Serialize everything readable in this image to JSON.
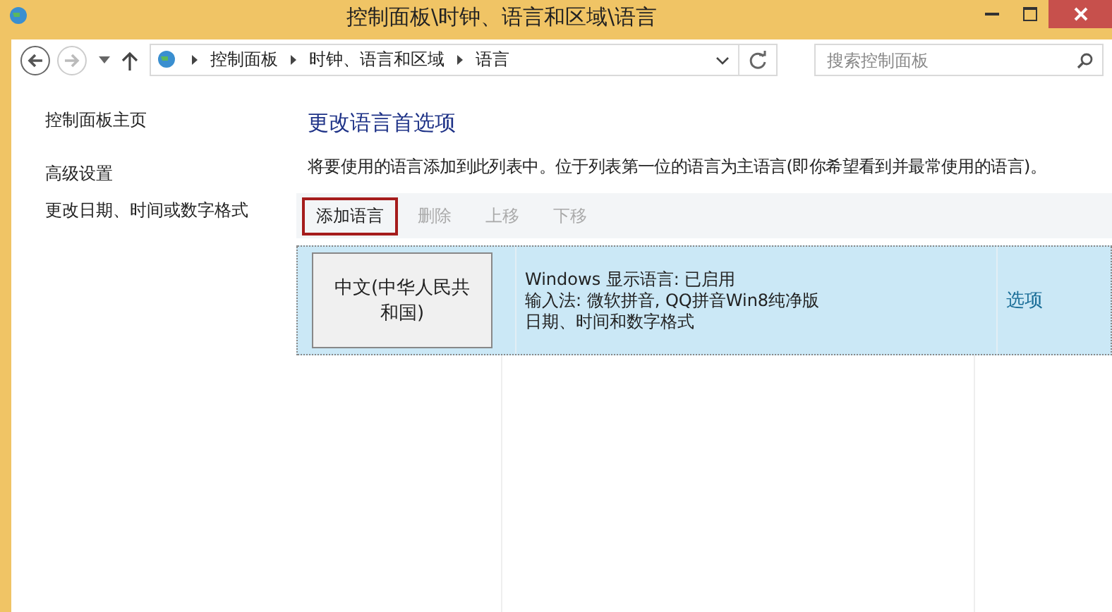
{
  "window": {
    "title": "控制面板\\时钟、语言和区域\\语言"
  },
  "address_bar": {
    "crumbs": [
      "控制面板",
      "时钟、语言和区域",
      "语言"
    ]
  },
  "search": {
    "placeholder": "搜索控制面板"
  },
  "sidebar": {
    "items": [
      {
        "label": "控制面板主页"
      },
      {
        "label": "高级设置"
      },
      {
        "label": "更改日期、时间或数字格式"
      }
    ]
  },
  "heading": "更改语言首选项",
  "description": "将要使用的语言添加到此列表中。位于列表第一位的语言为主语言(即你希望看到并最常使用的语言)。",
  "toolbar": [
    {
      "label": "添加语言",
      "disabled": false,
      "highlighted": true
    },
    {
      "label": "删除",
      "disabled": true,
      "highlighted": false
    },
    {
      "label": "上移",
      "disabled": true,
      "highlighted": false
    },
    {
      "label": "下移",
      "disabled": true,
      "highlighted": false
    }
  ],
  "languages": [
    {
      "name": "中文(中华人民共和国)",
      "selected": true,
      "details": [
        "Windows 显示语言: 已启用",
        "输入法: 微软拼音, QQ拼音Win8纯净版",
        "日期、时间和数字格式"
      ],
      "options_link": "选项"
    }
  ]
}
